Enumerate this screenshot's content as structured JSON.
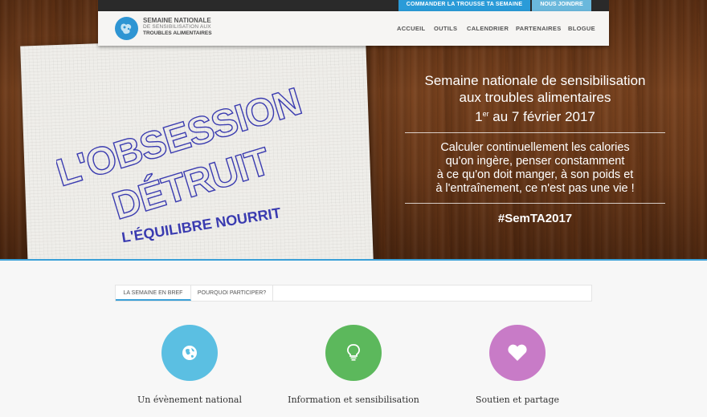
{
  "top_bar": {
    "order_kit_label": "COMMANDER LA TROUSSE TA SEMAINE",
    "join_label": "NOUS JOINDRE"
  },
  "logo": {
    "line1": "SEMAINE NATIONALE",
    "line2": "DE SENSIBILISATION AUX",
    "line3": "TROUBLES ALIMENTAIRES"
  },
  "nav": {
    "items": [
      "ACCUEIL",
      "OUTILS",
      "CALENDRIER",
      "PARTENAIRES",
      "BLOGUE"
    ]
  },
  "hero": {
    "napkin_line1": "L'OBSESSION",
    "napkin_line2": "DÉTRUIT",
    "napkin_line3": "L'ÉQUILIBRE NOURRIT",
    "title_line1": "Semaine nationale de sensibilisation",
    "title_line2": "aux troubles alimentaires",
    "date_prefix": "1",
    "date_sup": "er",
    "date_rest": " au 7 février 2017",
    "body_line1": "Calculer continuellement les calories",
    "body_line2": "qu'on ingère, penser constamment",
    "body_line3": "à ce qu'on doit manger, à son poids et",
    "body_line4": "à l'entraînement, ce n'est pas une vie !",
    "hashtag": "#SemTA2017"
  },
  "tabs": [
    {
      "label": "LA SEMAINE EN BREF",
      "active": true
    },
    {
      "label": "POURQUOI PARTICIPER?",
      "active": false
    }
  ],
  "features": [
    {
      "label": "Un évènement national",
      "color": "#5bbfe2",
      "icon": "globe-icon"
    },
    {
      "label": "Information et sensibilisation",
      "color": "#5cb85c",
      "icon": "lightbulb-icon"
    },
    {
      "label": "Soutien et partage",
      "color": "#c87bc7",
      "icon": "heart-icon"
    }
  ],
  "colors": {
    "accent_blue": "#2a9bd8",
    "join_blue": "#6ab8dc",
    "scribble_ink": "#3a3bb0"
  }
}
